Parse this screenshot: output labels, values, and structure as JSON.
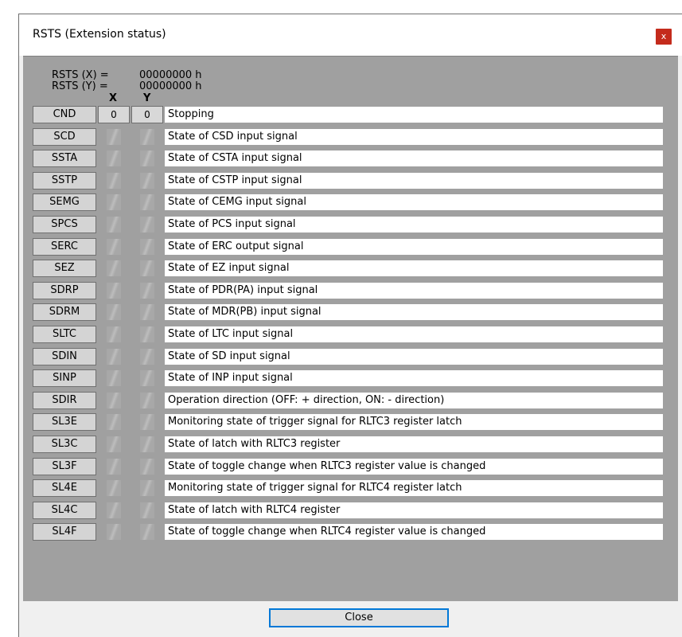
{
  "window": {
    "title": "RSTS (Extension status)",
    "close_icon_glyph": "x"
  },
  "registers": [
    {
      "label": "RSTS (X) =",
      "value": "00000000 h"
    },
    {
      "label": "RSTS (Y) =",
      "value": "00000000 h"
    }
  ],
  "columns": {
    "x": "X",
    "y": "Y"
  },
  "rows": [
    {
      "name": "CND",
      "x": "0",
      "y": "0",
      "desc": "Stopping"
    },
    {
      "name": "SCD",
      "x": "",
      "y": "",
      "desc": "State of CSD input signal"
    },
    {
      "name": "SSTA",
      "x": "",
      "y": "",
      "desc": "State of CSTA input signal"
    },
    {
      "name": "SSTP",
      "x": "",
      "y": "",
      "desc": "State of CSTP input signal"
    },
    {
      "name": "SEMG",
      "x": "",
      "y": "",
      "desc": "State of CEMG input signal"
    },
    {
      "name": "SPCS",
      "x": "",
      "y": "",
      "desc": "State of PCS input signal"
    },
    {
      "name": "SERC",
      "x": "",
      "y": "",
      "desc": "State of ERC output signal"
    },
    {
      "name": "SEZ",
      "x": "",
      "y": "",
      "desc": "State of EZ input signal"
    },
    {
      "name": "SDRP",
      "x": "",
      "y": "",
      "desc": "State of PDR(PA) input signal"
    },
    {
      "name": "SDRM",
      "x": "",
      "y": "",
      "desc": "State of MDR(PB) input signal"
    },
    {
      "name": "SLTC",
      "x": "",
      "y": "",
      "desc": "State of LTC input signal"
    },
    {
      "name": "SDIN",
      "x": "",
      "y": "",
      "desc": "State of SD input signal"
    },
    {
      "name": "SINP",
      "x": "",
      "y": "",
      "desc": "State of INP input signal"
    },
    {
      "name": "SDIR",
      "x": "",
      "y": "",
      "desc": "Operation direction (OFF: + direction, ON: - direction)"
    },
    {
      "name": "SL3E",
      "x": "",
      "y": "",
      "desc": "Monitoring state of trigger signal for RLTC3 register latch"
    },
    {
      "name": "SL3C",
      "x": "",
      "y": "",
      "desc": "State of latch with RLTC3 register"
    },
    {
      "name": "SL3F",
      "x": "",
      "y": "",
      "desc": "State of toggle change when RLTC3 register value is changed"
    },
    {
      "name": "SL4E",
      "x": "",
      "y": "",
      "desc": "Monitoring state of trigger signal for RLTC4 register latch"
    },
    {
      "name": "SL4C",
      "x": "",
      "y": "",
      "desc": "State of latch with RLTC4 register"
    },
    {
      "name": "SL4F",
      "x": "",
      "y": "",
      "desc": "State of toggle change when RLTC4 register value is changed"
    }
  ],
  "footer": {
    "close_label": "Close"
  }
}
